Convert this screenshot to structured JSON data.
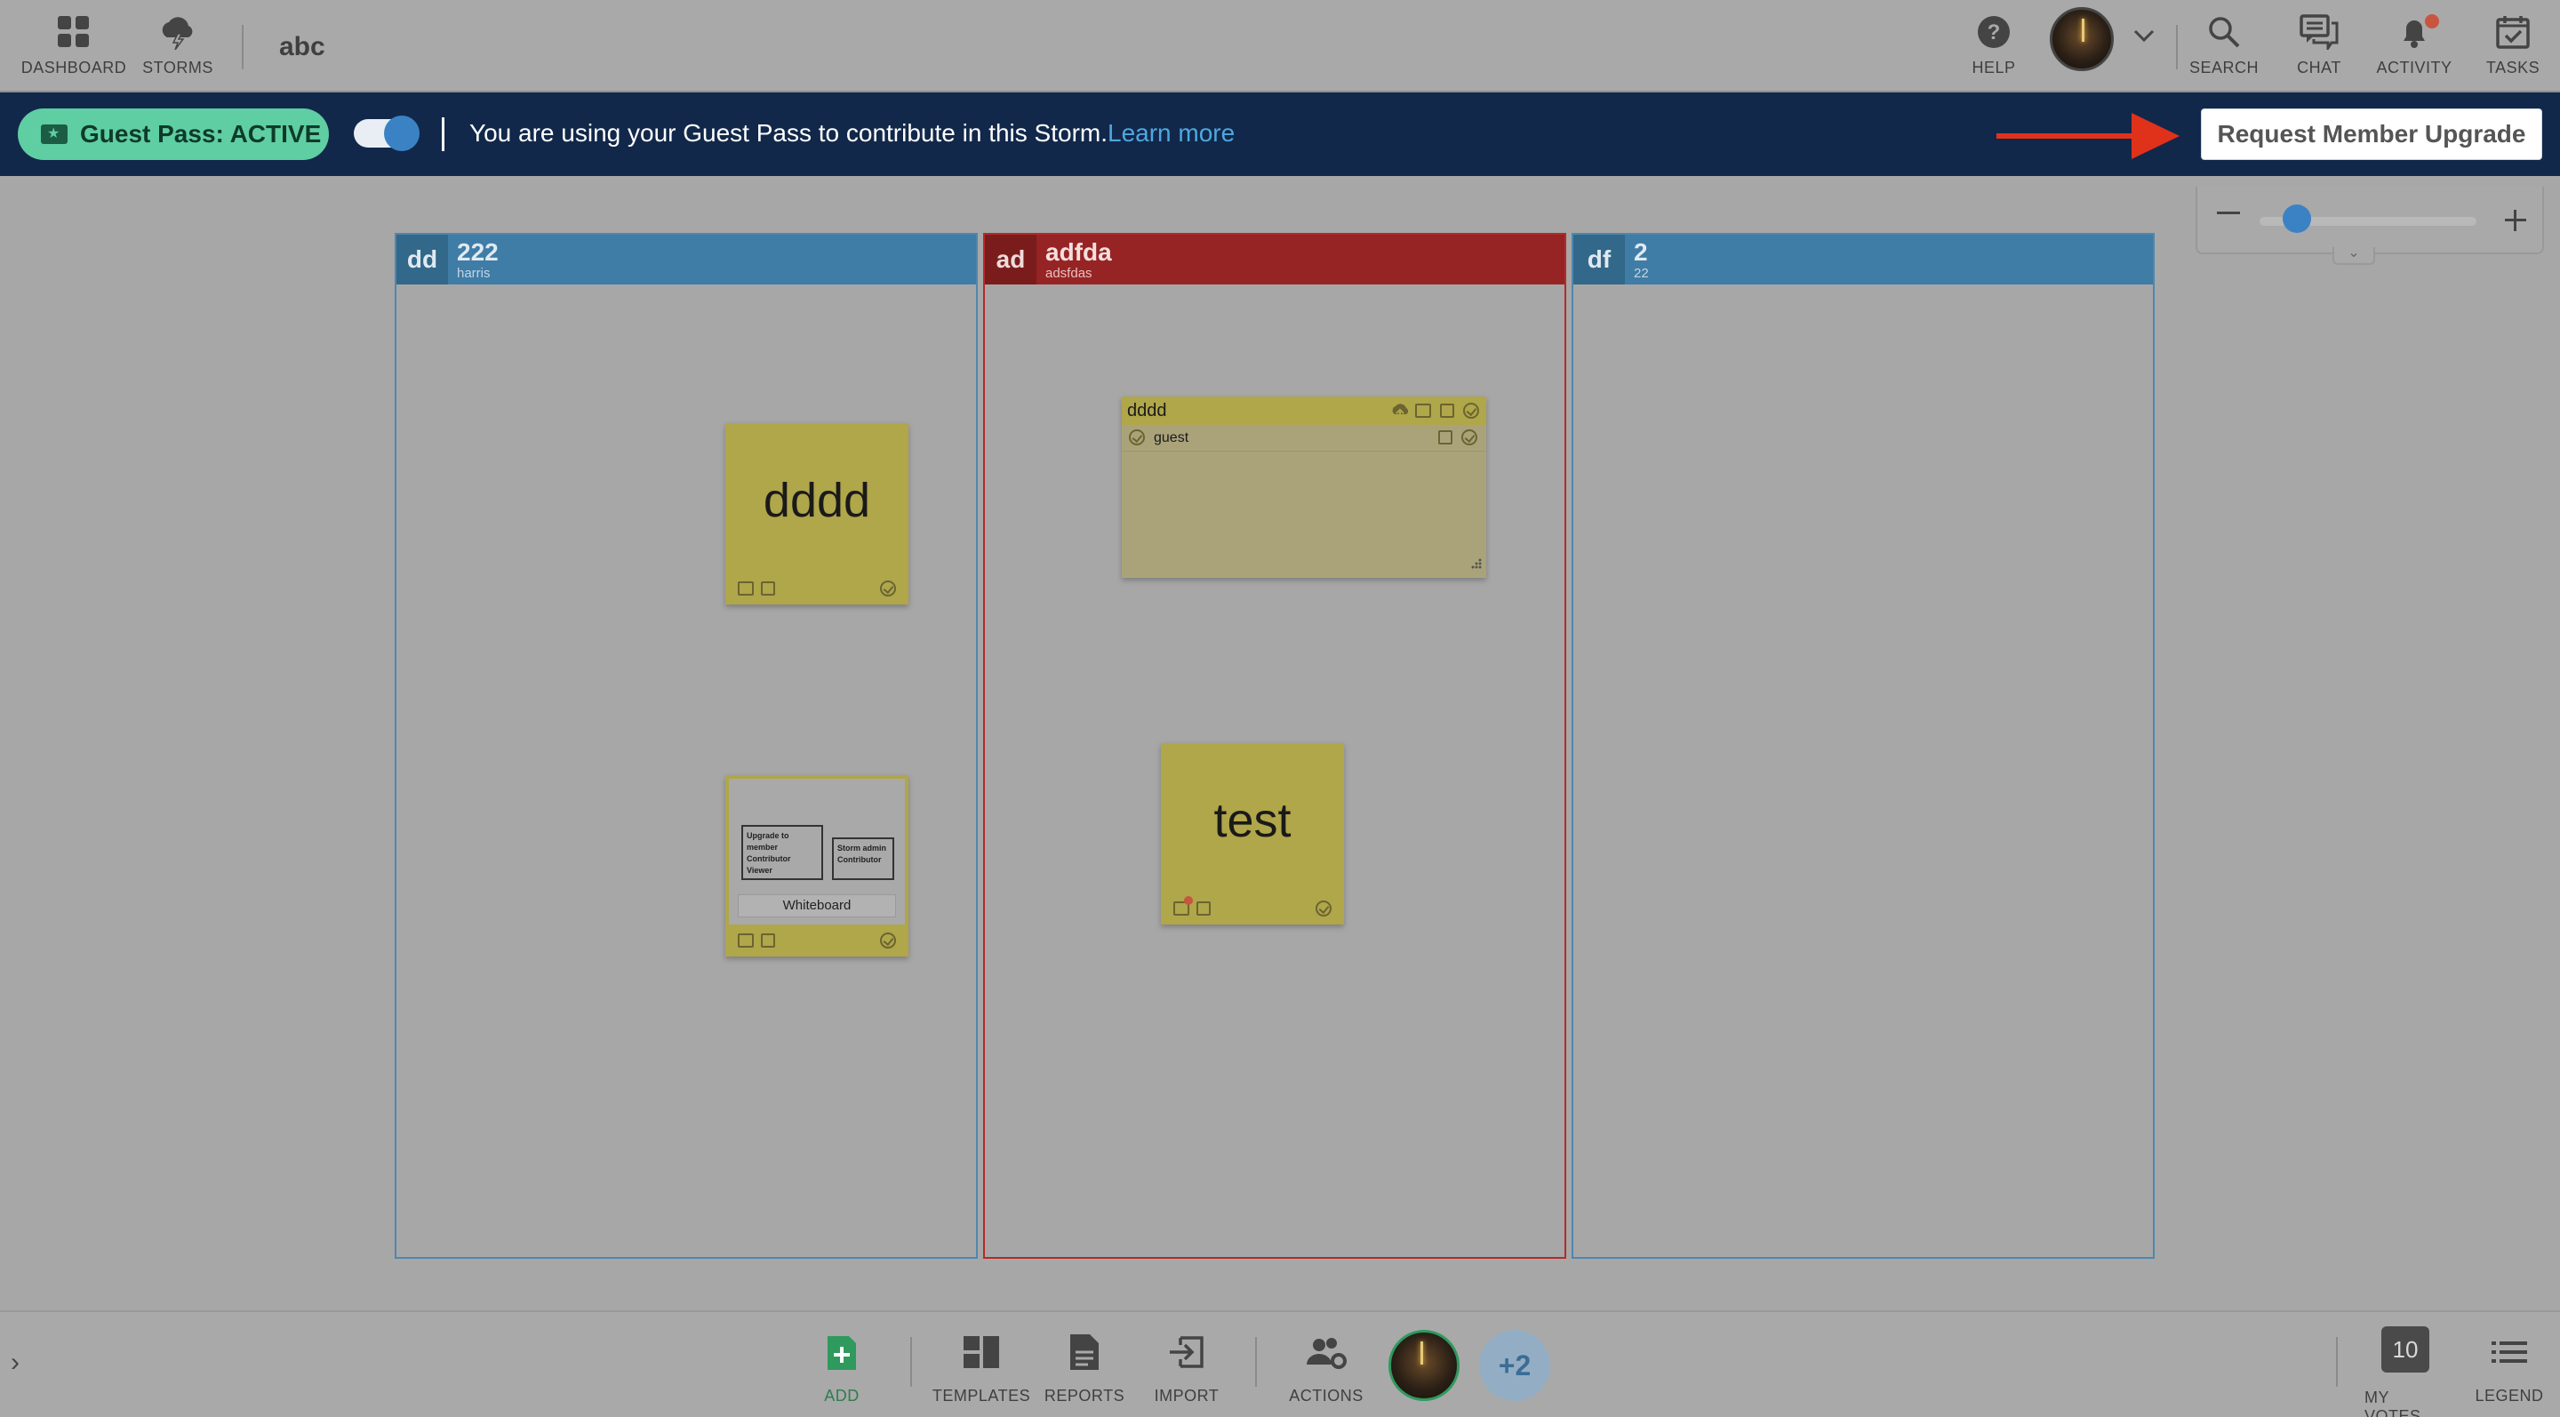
{
  "topbar": {
    "dashboard_label": "DASHBOARD",
    "storms_label": "STORMS",
    "app_title": "abc",
    "help_label": "HELP",
    "search_label": "SEARCH",
    "chat_label": "CHAT",
    "activity_label": "ACTIVITY",
    "tasks_label": "TASKS"
  },
  "guestbar": {
    "pass_label": "Guest Pass: ACTIVE",
    "message": "You are using your Guest Pass to contribute in this Storm.",
    "learn_more": "Learn more",
    "upgrade_button": "Request Member Upgrade",
    "toggle_on": true
  },
  "zoom": {
    "level": 0.2
  },
  "columns": [
    {
      "abbr": "dd",
      "title": "222",
      "subtitle": "harris",
      "color": "#3f7ca6"
    },
    {
      "abbr": "ad",
      "title": "adfda",
      "subtitle": "adsfdas",
      "color": "#962424"
    },
    {
      "abbr": "df",
      "title": "2",
      "subtitle": "22",
      "color": "#3f7ca6"
    }
  ],
  "cards": {
    "dddd_note": "dddd",
    "test_note": "test",
    "expanded_title": "dddd",
    "expanded_row": "guest",
    "whiteboard": {
      "label": "Whiteboard",
      "box1": [
        "Upgrade to member",
        "Contributor",
        "Viewer"
      ],
      "box2": [
        "Storm admin",
        "Contributor"
      ]
    }
  },
  "bottombar": {
    "add_label": "ADD",
    "templates_label": "TEMPLATES",
    "reports_label": "REPORTS",
    "import_label": "IMPORT",
    "actions_label": "ACTIONS",
    "extra_users": "+2",
    "votes_count": "10",
    "votes_label": "MY VOTES",
    "legend_label": "LEGEND"
  },
  "colors": {
    "guestbar_bg": "#12284a",
    "pass_green": "#5fcea3",
    "accent_blue": "#3b82c4",
    "arrow_red": "#e0321b",
    "sticky_yellow": "#b0a64a"
  }
}
